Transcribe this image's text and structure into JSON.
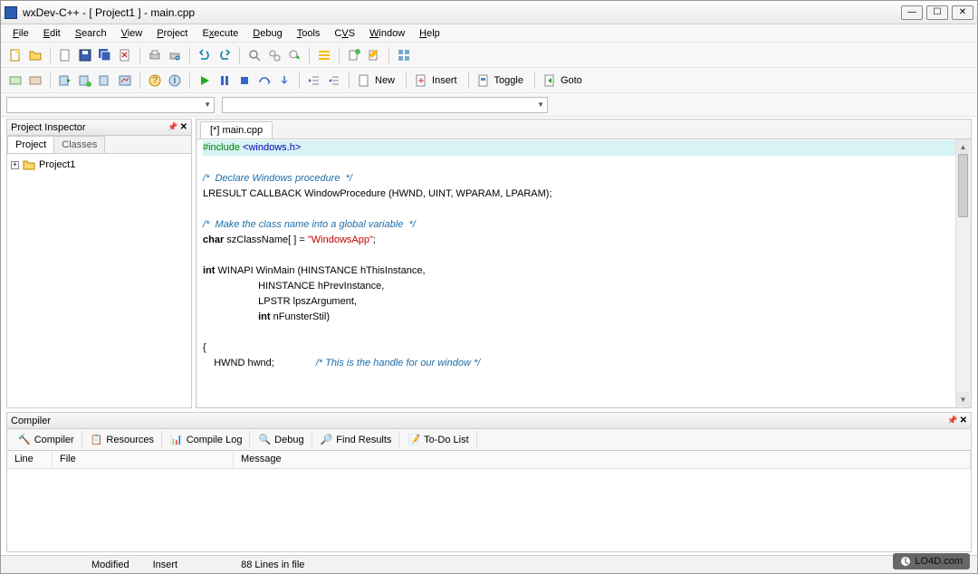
{
  "window": {
    "title": "wxDev-C++  - [ Project1 ] - main.cpp"
  },
  "menu": [
    "File",
    "Edit",
    "Search",
    "View",
    "Project",
    "Execute",
    "Debug",
    "Tools",
    "CVS",
    "Window",
    "Help"
  ],
  "menu_underline_idx": [
    0,
    0,
    0,
    0,
    0,
    1,
    0,
    0,
    1,
    0,
    0
  ],
  "toolbar2_labels": {
    "new": "New",
    "insert": "Insert",
    "toggle": "Toggle",
    "goto": "Goto"
  },
  "inspector": {
    "title": "Project Inspector",
    "tabs": [
      "Project",
      "Classes"
    ],
    "tree_item": "Project1"
  },
  "editor": {
    "tab": "[*] main.cpp",
    "lines": [
      {
        "t": "pre",
        "text": "#include <windows.h>"
      },
      {
        "t": "blank"
      },
      {
        "t": "cmt",
        "text": "/*  Declare Windows procedure  */"
      },
      {
        "t": "plain",
        "text": "LRESULT CALLBACK WindowProcedure (HWND, UINT, WPARAM, LPARAM);"
      },
      {
        "t": "blank"
      },
      {
        "t": "cmt",
        "text": "/*  Make the class name into a global variable  */"
      },
      {
        "t": "classn",
        "pre": "char",
        "mid": " szClassName[ ] = ",
        "str": "\"WindowsApp\"",
        "post": ";"
      },
      {
        "t": "blank"
      },
      {
        "t": "plain",
        "text": "int WINAPI WinMain (HINSTANCE hThisInstance,"
      },
      {
        "t": "plain",
        "text": "                    HINSTANCE hPrevInstance,"
      },
      {
        "t": "plain",
        "text": "                    LPSTR lpszArgument,"
      },
      {
        "t": "plain",
        "text": "                    int nFunsterStil)"
      },
      {
        "t": "blank"
      },
      {
        "t": "plain",
        "text": "{"
      },
      {
        "t": "handle",
        "text": "    HWND hwnd;               ",
        "cmt": "/* This is the handle for our window */"
      }
    ]
  },
  "compiler": {
    "title": "Compiler",
    "tabs": [
      "Compiler",
      "Resources",
      "Compile Log",
      "Debug",
      "Find Results",
      "To-Do List"
    ],
    "columns": [
      "Line",
      "File",
      "Message"
    ]
  },
  "status": {
    "modified": "Modified",
    "insert": "Insert",
    "lines": "88 Lines in file"
  },
  "watermark": "LO4D.com"
}
